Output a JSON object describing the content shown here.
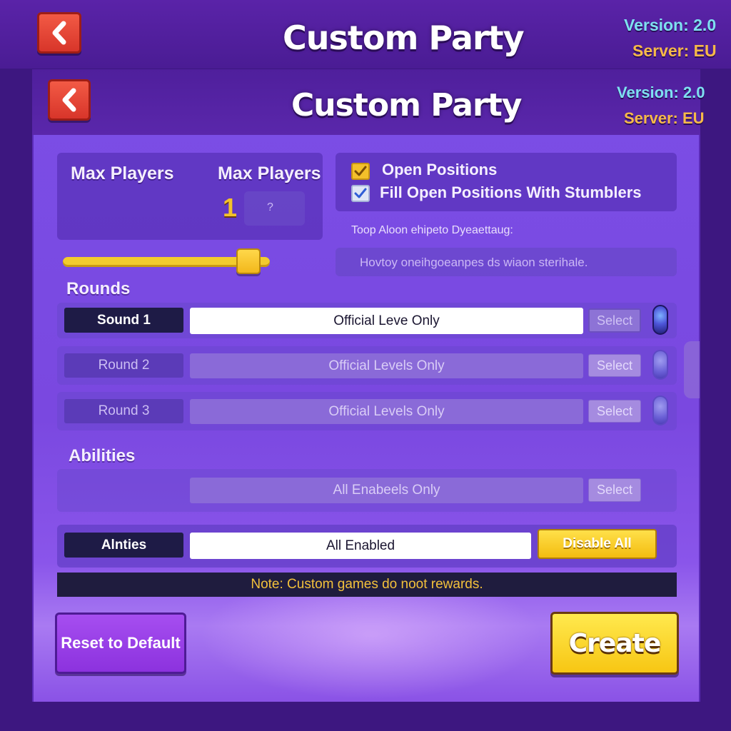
{
  "outer_header": {
    "title": "Custom Party",
    "version": "Version: 2.0",
    "server": "Server: EU"
  },
  "inner_header": {
    "title": "Custom Party",
    "version": "Version: 2.0",
    "server": "Server: EU"
  },
  "max_players": {
    "label_left": "Max Players",
    "label_right": "Max Players",
    "value": "1",
    "secondary_value": "?",
    "slider_level": 0.95
  },
  "options": {
    "open_positions": {
      "label": "Open Positions",
      "checked": true
    },
    "fill_open_positions": {
      "label": "Fill Open Positions With Stumblers",
      "checked": true
    },
    "hint": "Toop Aloon ehipeto Dyeaettaug:",
    "description": "Hovtoy oneihgoeanpes ds wiaon sterihale."
  },
  "rounds": {
    "section_label": "Rounds",
    "items": [
      {
        "label": "Sound 1",
        "value": "Official Leve Only",
        "button": "Select",
        "active": true
      },
      {
        "label": "Round 2",
        "value": "Official Levels Only",
        "button": "Select",
        "active": false
      },
      {
        "label": "Round 3",
        "value": "Official Levels Only",
        "button": "Select",
        "active": false
      }
    ]
  },
  "abilities": {
    "section_label": "Abilities",
    "preset_row": {
      "value": "All Enabeels Only",
      "button": "Select"
    },
    "main_row": {
      "label": "Alnties",
      "value": "All Enabled",
      "button": "Disable All"
    }
  },
  "note": "Note: Custom games do noot rewards.",
  "footer": {
    "reset_label": "Reset to Default",
    "create_label": "Create"
  },
  "colors": {
    "background": "#3d1780",
    "panel": "#7b4ee6",
    "accent_yellow": "#f7c613",
    "back_red": "#e0402f",
    "version_cyan": "#7ee0f0",
    "server_orange": "#f6b948",
    "note_yellow": "#f3c13b"
  },
  "icons": {
    "back": "chevron-left-icon",
    "checkbox": "check-icon",
    "round_orb": "orb-icon"
  }
}
